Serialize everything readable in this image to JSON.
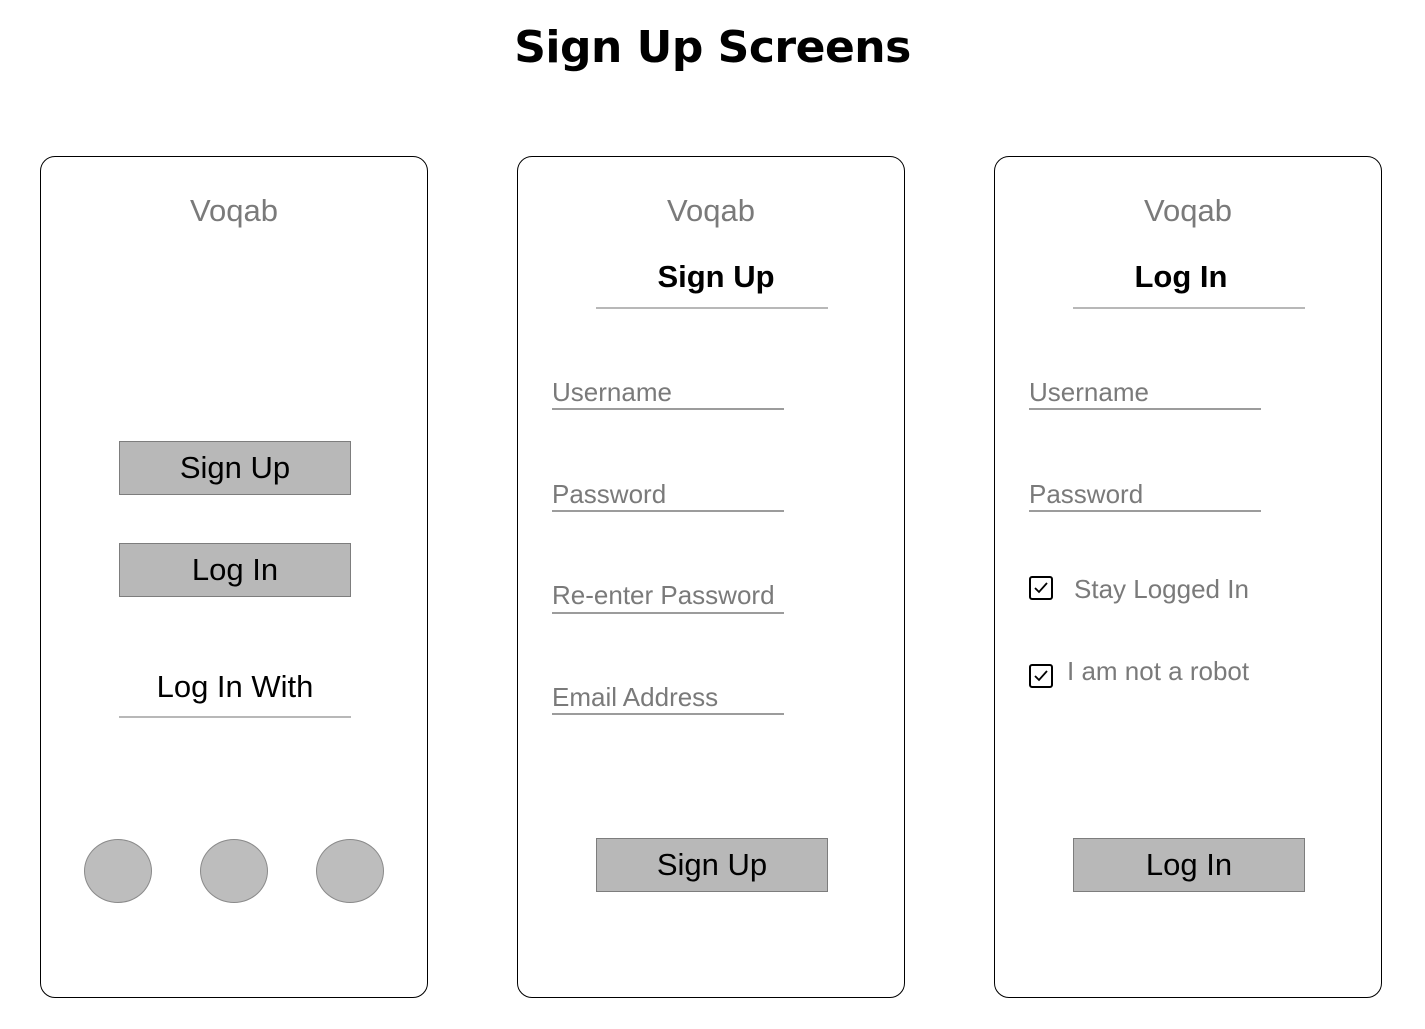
{
  "title": "Sign Up Screens",
  "screens": {
    "welcome": {
      "app_name": "Voqab",
      "signup_button": "Sign Up",
      "login_button": "Log In",
      "login_with_label": "Log In With"
    },
    "signup": {
      "app_name": "Voqab",
      "title": "Sign Up",
      "fields": [
        "Username",
        "Password",
        "Re-enter Password",
        "Email Address"
      ],
      "submit_button": "Sign Up"
    },
    "login": {
      "app_name": "Voqab",
      "title": "Log In",
      "fields": [
        "Username",
        "Password"
      ],
      "checkboxes": [
        {
          "label": "Stay Logged In",
          "checked": true
        },
        {
          "label": "I am not a robot",
          "checked": true
        }
      ],
      "submit_button": "Log In"
    }
  },
  "colors": {
    "button_fill": "#b8b8b8",
    "placeholder_text": "#7a7a7a",
    "circle_fill": "#bdbdbd"
  }
}
